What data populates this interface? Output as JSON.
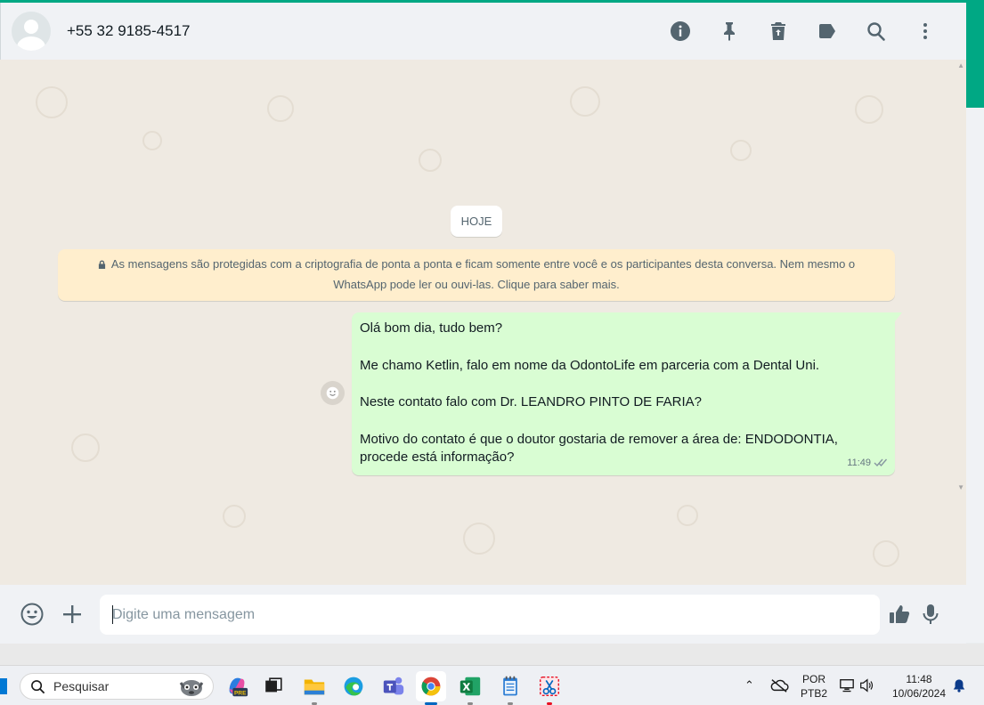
{
  "header": {
    "contact_name": "+55 32 9185-4517",
    "icons": [
      "info-icon",
      "pin-icon",
      "delete-icon",
      "label-icon",
      "search-icon",
      "menu-icon"
    ]
  },
  "chat": {
    "day_label": "HOJE",
    "encryption_notice": "As mensagens são protegidas com a criptografia de ponta a ponta e ficam somente entre você e os participantes desta conversa. Nem mesmo o WhatsApp pode ler ou ouvi-las. Clique para saber mais.",
    "message": {
      "lines": [
        "Olá bom dia, tudo bem?",
        "Me chamo Ketlin, falo em nome da OdontoLife em parceria com a Dental Uni.",
        "Neste contato falo com Dr. LEANDRO PINTO DE FARIA?",
        "Motivo do contato é que o doutor gostaria de remover a área de: ENDODONTIA, procede está informação?"
      ],
      "time": "11:49",
      "status": "delivered"
    }
  },
  "compose": {
    "placeholder": "Digite uma mensagem",
    "value": ""
  },
  "taskbar": {
    "search_label": "Pesquisar",
    "lang_top": "POR",
    "lang_bottom": "PTB2",
    "time": "11:48",
    "date": "10/06/2024",
    "copilot_badge": "PRE"
  },
  "colors": {
    "accent": "#00a884",
    "outgoing_bubble": "#d9fdd3",
    "notice_bg": "#ffeecd",
    "chat_bg": "#efeae2"
  }
}
